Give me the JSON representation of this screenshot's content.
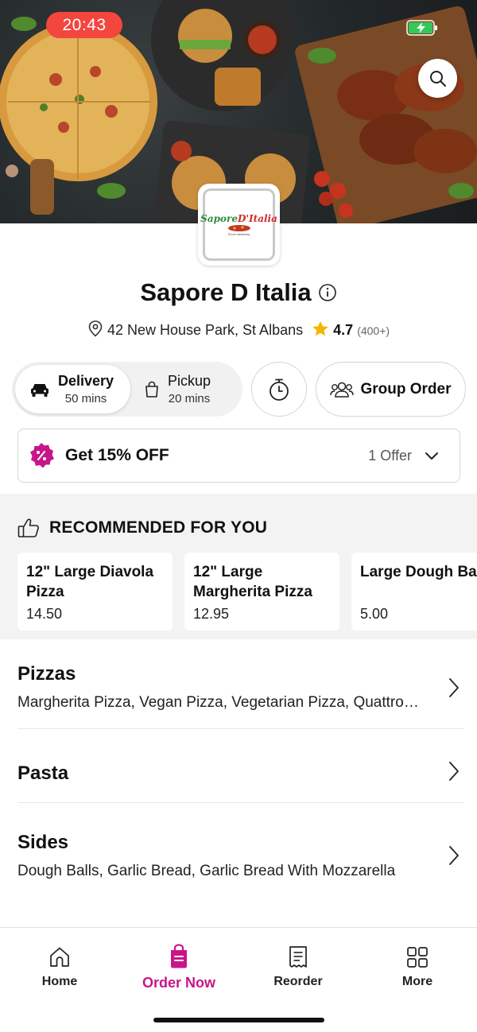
{
  "status_bar": {
    "time": "20:43"
  },
  "restaurant": {
    "logo_text_1": "Sapore",
    "logo_text_2": "D'Italia",
    "logo_subtext": "Pizza takeaway",
    "name": "Sapore D Italia",
    "address": "42 New House Park, St Albans",
    "rating": "4.7",
    "reviews": "(400+)"
  },
  "order_modes": {
    "delivery": {
      "label": "Delivery",
      "time": "50 mins"
    },
    "pickup": {
      "label": "Pickup",
      "time": "20 mins"
    },
    "group_order": "Group Order"
  },
  "offer": {
    "title": "Get 15% OFF",
    "count": "1 Offer"
  },
  "recommended": {
    "title": "RECOMMENDED FOR YOU",
    "items": [
      {
        "name": "12\" Large Diavola Pizza",
        "price": "14.50"
      },
      {
        "name": "12\" Large Margherita Pizza",
        "price": "12.95"
      },
      {
        "name": "Large Dough Ba",
        "price": "5.00"
      }
    ]
  },
  "categories": [
    {
      "name": "Pizzas",
      "description": "Margherita Pizza, Vegan Pizza, Vegetarian Pizza, Quattro Formaggi Pizza"
    },
    {
      "name": "Pasta",
      "description": ""
    },
    {
      "name": "Sides",
      "description": "Dough Balls, Garlic Bread, Garlic Bread With Mozzarella"
    }
  ],
  "tabs": [
    {
      "label": "Home",
      "icon": "home-icon"
    },
    {
      "label": "Order Now",
      "icon": "order-bag-icon"
    },
    {
      "label": "Reorder",
      "icon": "receipt-icon"
    },
    {
      "label": "More",
      "icon": "grid-icon"
    }
  ],
  "colors": {
    "accent": "#c8158a",
    "time_pill": "#f2463e",
    "star": "#f5b400"
  }
}
